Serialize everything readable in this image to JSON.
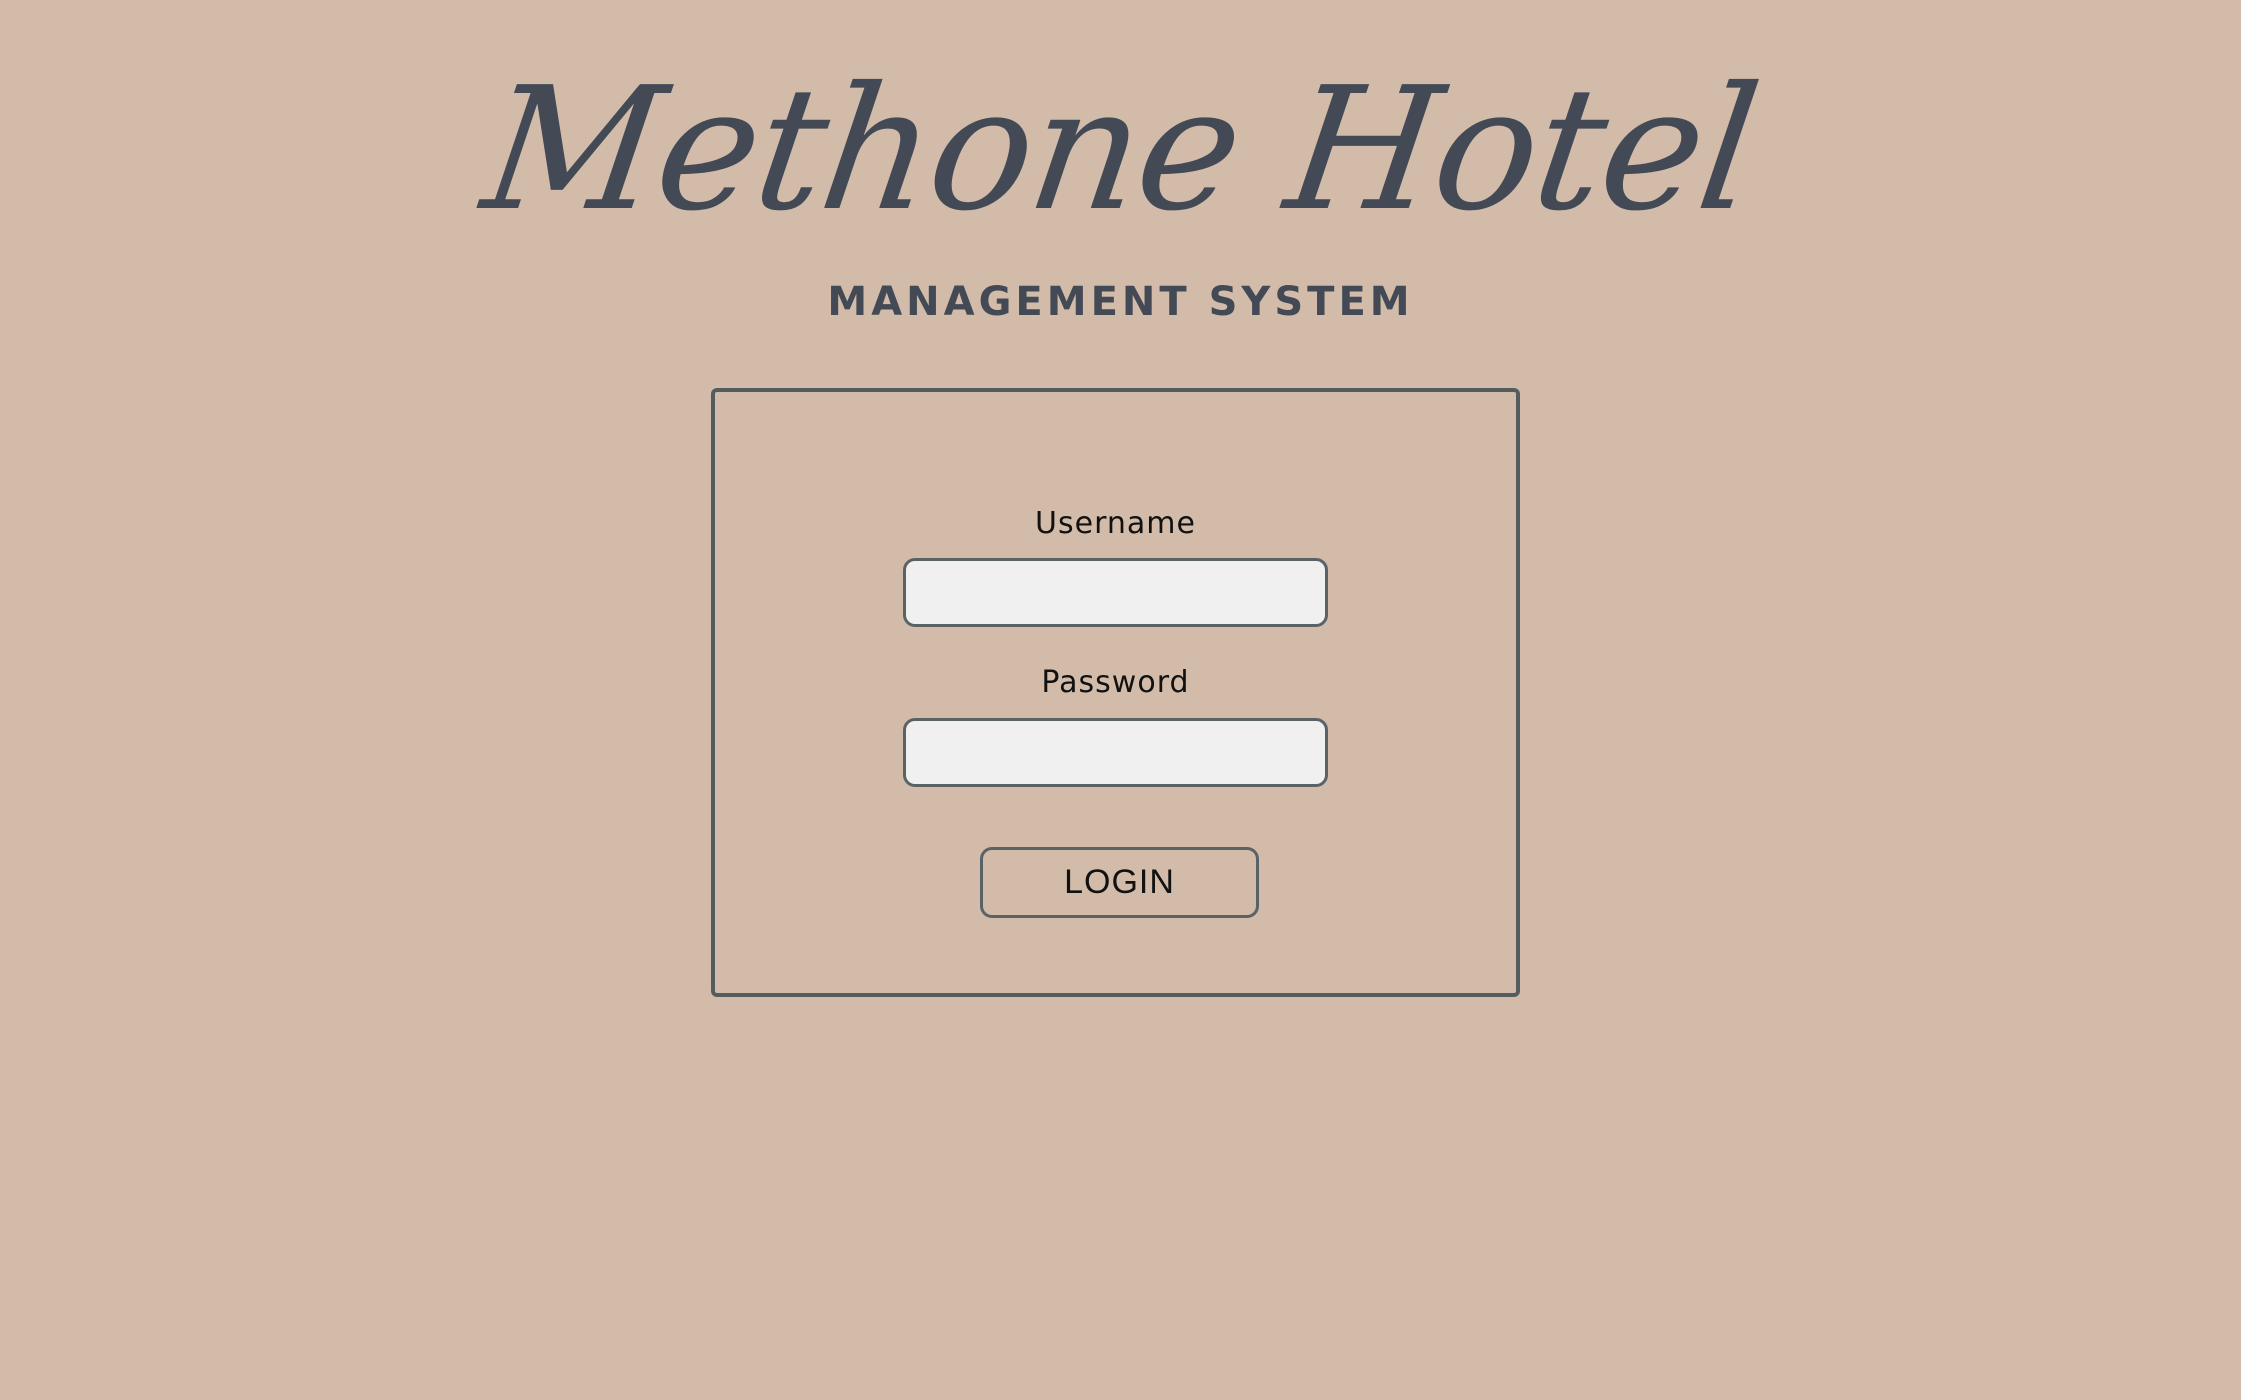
{
  "header": {
    "title": "Methone Hotel",
    "subtitle": "MANAGEMENT SYSTEM"
  },
  "login_form": {
    "username_label": "Username",
    "username_value": "",
    "password_label": "Password",
    "password_value": "",
    "submit_label": "LOGIN"
  },
  "colors": {
    "background": "#d2bca9",
    "title_text": "#434a55",
    "panel_border": "#555c60",
    "input_fill": "#f0f0f0"
  }
}
